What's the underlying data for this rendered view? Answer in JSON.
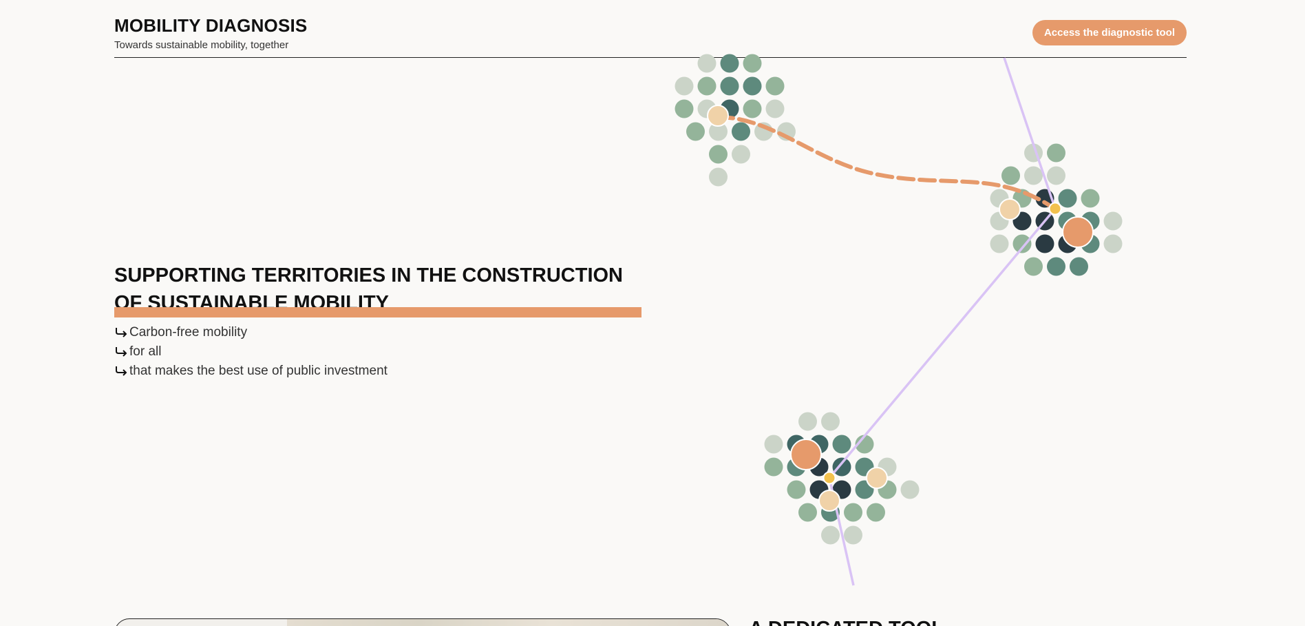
{
  "header": {
    "title": "MOBILITY DIAGNOSIS",
    "subtitle": "Towards sustainable mobility, together",
    "cta_label": "Access the diagnostic tool"
  },
  "hero": {
    "title": "SUPPORTING TERRITORIES IN THE CONSTRUCTION OF SUSTAINABLE MOBILITY",
    "bullets": [
      "Carbon-free mobility",
      "for all",
      "that makes the best use of public investment"
    ]
  },
  "next_section": {
    "heading": "A DEDICATED TOOL"
  },
  "colors": {
    "accent": "#e69a6b",
    "accent_light": "#f0d2a8",
    "node": "#f2c14e",
    "line": "#d9c3f5",
    "dot_pale": "#cbd4c8",
    "dot_light": "#94b49a",
    "dot_mid": "#5e8a7d",
    "dot_teal": "#3f6664",
    "dot_dark": "#2a3a42",
    "background": "#faf9f7"
  },
  "icons": {
    "bullet": "return-arrow-icon"
  }
}
